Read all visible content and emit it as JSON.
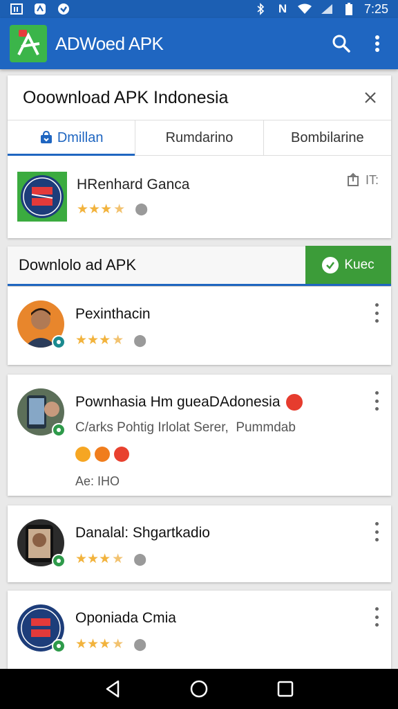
{
  "status_bar": {
    "time": "7:25"
  },
  "app_bar": {
    "title": "ADWoed APK",
    "icons": [
      "search-icon",
      "more-vert-icon"
    ]
  },
  "card": {
    "title": "Ooownload APK Indonesia",
    "tabs": [
      {
        "label": "Dmillan",
        "active": true
      },
      {
        "label": "Rumdarino",
        "active": false
      },
      {
        "label": "Bombilarine",
        "active": false
      }
    ],
    "featured_app": {
      "name": "HRenhard Ganca",
      "rating_stars": 3.5,
      "action_text": "IT:"
    }
  },
  "section": {
    "title": "Downlolo ad APK",
    "button_label": "Kuec"
  },
  "list": [
    {
      "title": "Pexinthacin",
      "rating_stars": 3.5
    },
    {
      "title": "Pownhasia Hm gueaDAdonesia",
      "subtitle": "C/arks Pohtig Irlolat Serer,  Pummdab",
      "meta": "Ae: IHO"
    },
    {
      "title": "Danalal: Shgartkadio",
      "rating_stars": 3.5
    },
    {
      "title": "Oponiada Cmia",
      "rating_stars": 3.5
    }
  ],
  "colors": {
    "primary": "#1f66c1",
    "accent_green": "#3c9c39",
    "star": "#f2b33d"
  }
}
